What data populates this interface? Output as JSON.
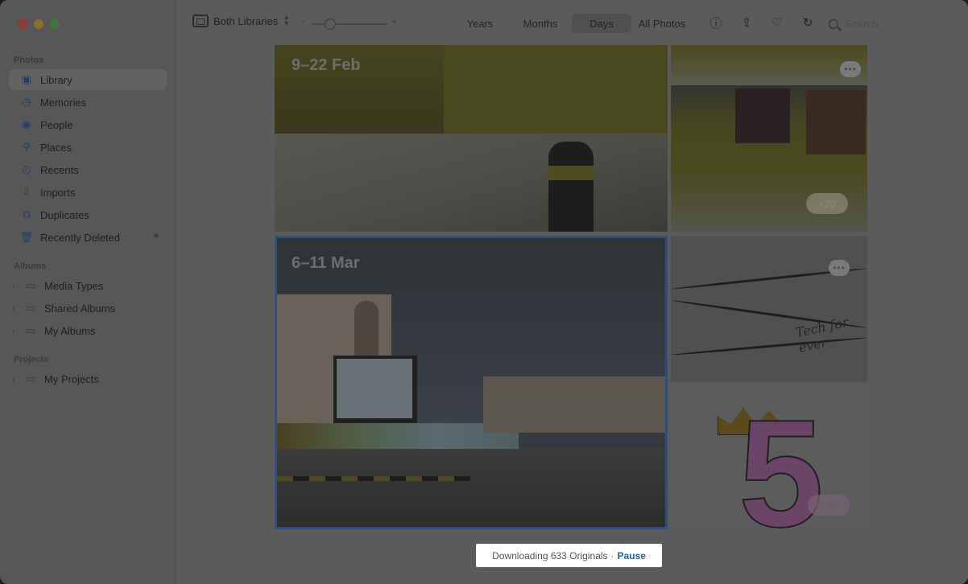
{
  "window": {
    "traffic_lights": [
      "close",
      "minimize",
      "zoom"
    ]
  },
  "sidebar": {
    "sections": {
      "photos": "Photos",
      "albums": "Albums",
      "projects": "Projects"
    },
    "photos_items": [
      {
        "label": "Library",
        "icon": "library-icon",
        "active": true
      },
      {
        "label": "Memories",
        "icon": "memories-icon"
      },
      {
        "label": "People",
        "icon": "people-icon"
      },
      {
        "label": "Places",
        "icon": "places-icon"
      },
      {
        "label": "Recents",
        "icon": "recents-icon"
      },
      {
        "label": "Imports",
        "icon": "imports-icon"
      },
      {
        "label": "Duplicates",
        "icon": "duplicates-icon"
      },
      {
        "label": "Recently Deleted",
        "icon": "trash-icon",
        "locked": true
      }
    ],
    "album_items": [
      {
        "label": "Media Types",
        "icon": "folder-icon"
      },
      {
        "label": "Shared Albums",
        "icon": "shared-folder-icon"
      },
      {
        "label": "My Albums",
        "icon": "folder-icon"
      }
    ],
    "project_items": [
      {
        "label": "My Projects",
        "icon": "folder-icon"
      }
    ]
  },
  "toolbar": {
    "library_selector": "Both Libraries",
    "tabs": [
      "Years",
      "Months",
      "Days",
      "All Photos"
    ],
    "active_tab": "Days",
    "search_placeholder": "Search",
    "icons": [
      "info-icon",
      "share-icon",
      "heart-icon",
      "rotate-icon",
      "search-icon"
    ]
  },
  "content": {
    "groups": [
      {
        "date": "9–22 Feb",
        "count_badge": "+20"
      },
      {
        "date": "6–11 Mar",
        "count_badge": "+30"
      }
    ],
    "more_label": "•••",
    "doodle_text": "Tech for ever"
  },
  "status": {
    "message": "Downloading 633 Originals",
    "separator": "·",
    "action": "Pause"
  },
  "colors": {
    "accent": "#1a63b8",
    "selection_border": "#2e4d80"
  }
}
